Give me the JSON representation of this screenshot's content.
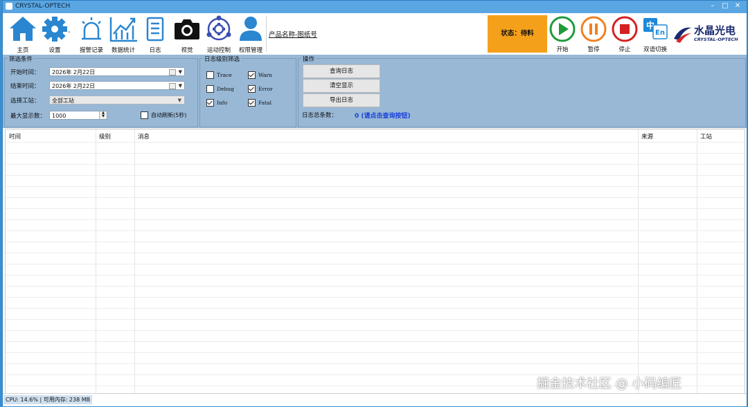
{
  "window": {
    "title": "CRYSTAL-OPTECH"
  },
  "toolbar": {
    "items": [
      {
        "label": "主页",
        "icon": "home-icon"
      },
      {
        "label": "设置",
        "icon": "gear-icon"
      },
      {
        "label": "报警记录",
        "icon": "alarm-icon"
      },
      {
        "label": "数据统计",
        "icon": "chart-icon"
      },
      {
        "label": "日志",
        "icon": "log-icon"
      },
      {
        "label": "视觉",
        "icon": "camera-icon"
      },
      {
        "label": "运动控制",
        "icon": "motion-icon"
      },
      {
        "label": "权限管理",
        "icon": "user-icon"
      }
    ],
    "product_name": "产品名称-图纸号",
    "status_text": "状态：待料",
    "controls": [
      {
        "label": "开始",
        "icon": "play-icon"
      },
      {
        "label": "暂停",
        "icon": "pause-icon"
      },
      {
        "label": "停止",
        "icon": "stop-icon"
      },
      {
        "label": "双语切换",
        "icon": "language-icon"
      }
    ],
    "logo": {
      "cn": "水晶光电",
      "en": "CRYSTAL-OPTECH"
    }
  },
  "filter": {
    "title": "筛选条件",
    "start_label": "开始时间：",
    "start_value": "2026年  2月22日",
    "end_label": "结束时间：",
    "end_value": "2026年  2月22日",
    "station_label": "选择工站：",
    "station_value": "全部工站",
    "max_label": "最大显示数：",
    "max_value": "1000",
    "auto_refresh_label": "自动刷新(5秒)",
    "auto_refresh_checked": false
  },
  "levels": {
    "title": "日志级别筛选",
    "items": [
      {
        "label": "Trace",
        "checked": false
      },
      {
        "label": "Warn",
        "checked": true
      },
      {
        "label": "Debug",
        "checked": false
      },
      {
        "label": "Error",
        "checked": true
      },
      {
        "label": "Info",
        "checked": true
      },
      {
        "label": "Fatal",
        "checked": true
      }
    ]
  },
  "actions": {
    "title": "操作",
    "query": "查询日志",
    "clear": "清空显示",
    "export": "导出日志",
    "total_label": "日志总条数：",
    "total_value": "0 (请点击查询按钮)"
  },
  "table": {
    "columns": [
      "时间",
      "级别",
      "消息",
      "来源",
      "工站"
    ],
    "rows": []
  },
  "statusbar": {
    "text": "CPU: 14.6% | 可用内存: 238 MB"
  },
  "watermark": "掘金技术社区 @ 小码编匠",
  "colors": {
    "titlebar": "#5aa6e2",
    "status_box": "#f5a01a",
    "filter_bg": "#98b8d6",
    "total_value": "#1a3fd8",
    "icon_blue": "#2a86d0"
  }
}
